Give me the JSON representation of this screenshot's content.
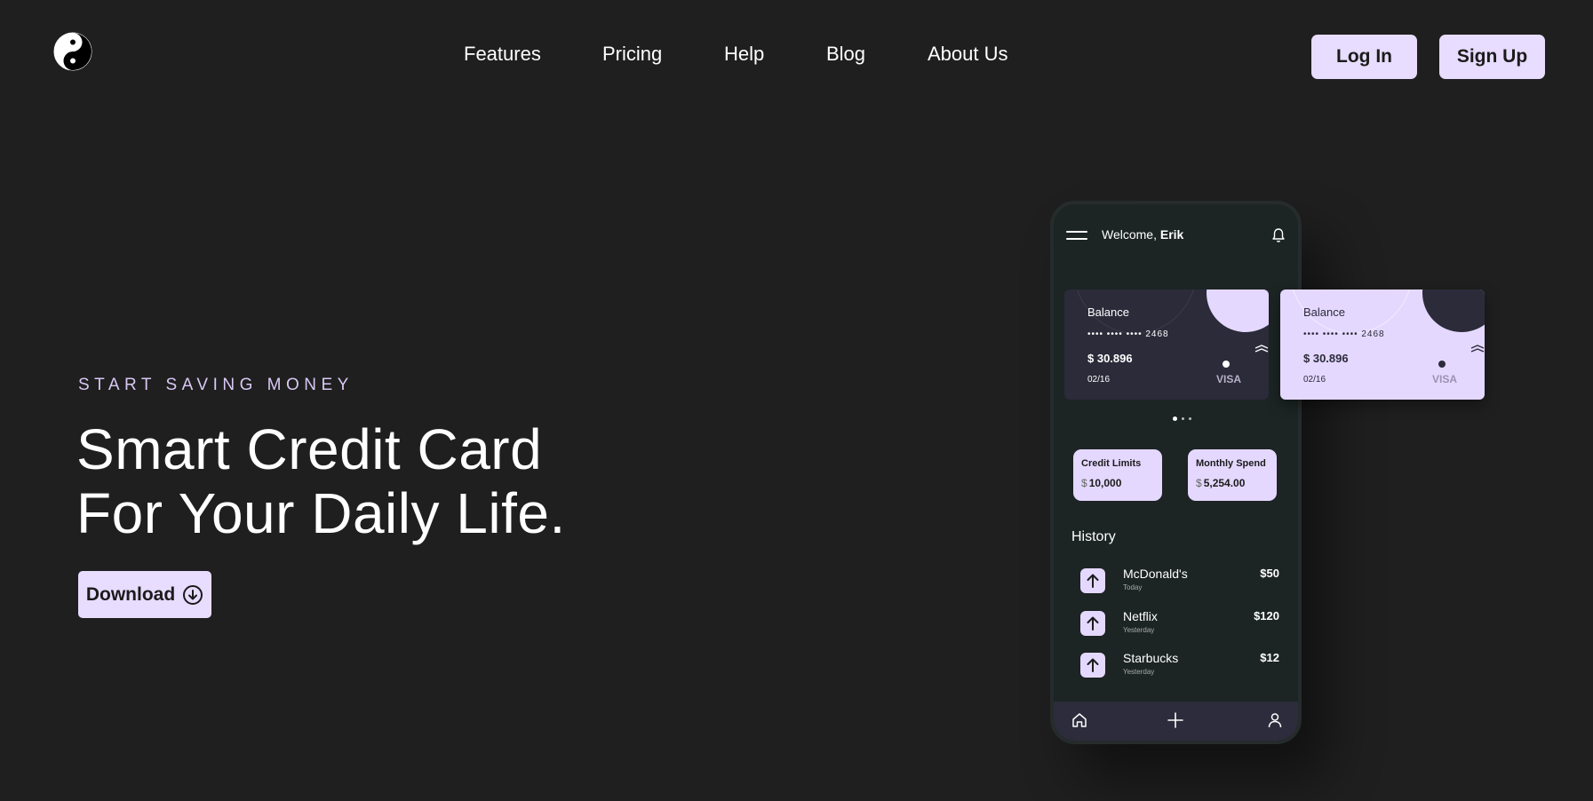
{
  "header": {
    "logo_icon": "yin-yang-icon",
    "nav": [
      "Features",
      "Pricing",
      "Help",
      "Blog",
      "About Us"
    ],
    "login_label": "Log In",
    "signup_label": "Sign Up"
  },
  "hero": {
    "eyebrow": "START SAVING MONEY",
    "headline_line1": "Smart Credit Card",
    "headline_line2": "For Your Daily Life.",
    "download_label": "Download",
    "download_icon": "arrow-down-circle-icon"
  },
  "phone": {
    "welcome_prefix": "Welcome,",
    "welcome_name": "Erik",
    "cards": [
      {
        "title": "Balance",
        "number": "•••• •••• •••• 2468",
        "balance": "$ 30.896",
        "expiry": "02/16",
        "brand": "VISA"
      },
      {
        "title": "Balance",
        "number": "•••• •••• •••• 2468",
        "balance": "$ 30.896",
        "expiry": "02/16",
        "brand": "VISA"
      }
    ],
    "stats": [
      {
        "label": "Credit Limits",
        "currency": "$",
        "value": "10,000"
      },
      {
        "label": "Monthly Spend",
        "currency": "$",
        "value": "5,254.00"
      }
    ],
    "history_title": "History",
    "history": [
      {
        "name": "McDonald's",
        "when": "Today",
        "amount": "$50"
      },
      {
        "name": "Netflix",
        "when": "Yesterday",
        "amount": "$120"
      },
      {
        "name": "Starbucks",
        "when": "Yesterday",
        "amount": "$12"
      }
    ],
    "bottom_nav": [
      "home-icon",
      "plus-icon",
      "user-icon"
    ]
  },
  "colors": {
    "background": "#1f1f1f",
    "accent": "#e8dcff",
    "phone": "#1c2424",
    "card_dark": "#2b2b3a"
  }
}
